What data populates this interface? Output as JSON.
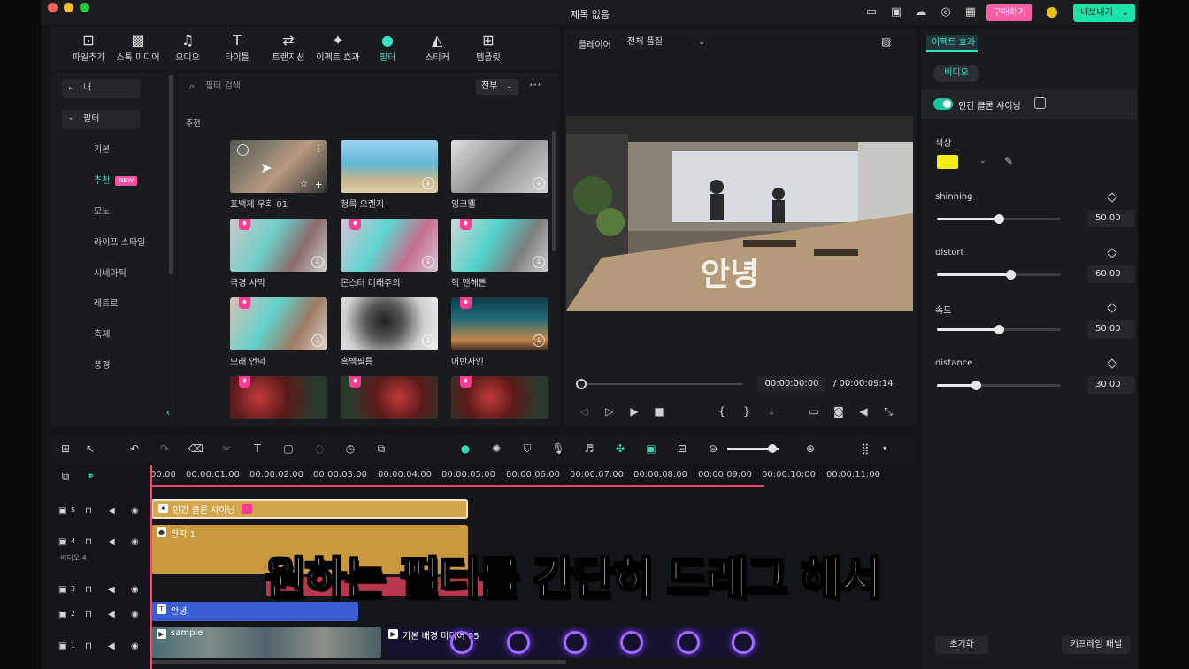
{
  "window": {
    "title": "제목 없음"
  },
  "header": {
    "buy_label": "구매하기",
    "export_label": "내보내기"
  },
  "media_tabs": [
    {
      "label": "파일추가",
      "icon": "import-icon"
    },
    {
      "label": "스톡 미디어",
      "icon": "stock-media-icon"
    },
    {
      "label": "오디오",
      "icon": "music-note-icon"
    },
    {
      "label": "타이틀",
      "icon": "title-text-icon"
    },
    {
      "label": "트랜지션",
      "icon": "transition-icon"
    },
    {
      "label": "이펙트 효과",
      "icon": "effects-sparkle-icon"
    },
    {
      "label": "필터",
      "icon": "filter-icon"
    },
    {
      "label": "스티커",
      "icon": "sticker-icon"
    },
    {
      "label": "템플릿",
      "icon": "template-icon"
    }
  ],
  "sidebar": {
    "mine_label": "내",
    "filter_label": "필터",
    "new_badge": "NEW",
    "items": [
      "기본",
      "추천",
      "모노",
      "라이프 스타일",
      "시네마틱",
      "레트로",
      "축제",
      "풍경"
    ]
  },
  "filters": {
    "search_placeholder": "필터 검색",
    "scope": "전부",
    "section": "추천",
    "items": [
      {
        "label": "표백제 우회 01"
      },
      {
        "label": "청록 오렌지"
      },
      {
        "label": "잉크웰"
      },
      {
        "label": "국경 사막"
      },
      {
        "label": "몬스터 미래주의"
      },
      {
        "label": "핵 맨해튼"
      },
      {
        "label": "모래 언덕"
      },
      {
        "label": "흑백필름"
      },
      {
        "label": "어반사인"
      }
    ]
  },
  "player": {
    "tab": "플레이어",
    "quality": "전체 품질",
    "overlay_text": "안녕",
    "current_time": "00:00:00:00",
    "total_time": "/ 00:00:09:14"
  },
  "effects": {
    "tab": "이펙트 효과",
    "video_btn": "비디오",
    "effect_name": "인간 클론 샤이닝",
    "color_label": "색상",
    "color_value": "#f2ee19",
    "params": [
      {
        "name": "shinning",
        "value": "50.00",
        "level": 0.5
      },
      {
        "name": "distort",
        "value": "60.00",
        "level": 0.6
      },
      {
        "name": "속도",
        "value": "50.00",
        "level": 0.5
      },
      {
        "name": "distance",
        "value": "30.00",
        "level": 0.3
      }
    ],
    "reset_label": "초기화",
    "keyframe_label": "키프레임 패널"
  },
  "timeline": {
    "ticks": [
      "00:00",
      "00:00:01:00",
      "00:00:02:00",
      "00:00:03:00",
      "00:00:04:00",
      "00:00:05:00",
      "00:00:06:00",
      "00:00:07:00",
      "00:00:08:00",
      "00:00:09:00",
      "00:00:10:00",
      "00:00:11:00"
    ],
    "tracks": [
      {
        "num": "5"
      },
      {
        "num": "4",
        "label": "비디오 4"
      },
      {
        "num": "3"
      },
      {
        "num": "2"
      },
      {
        "num": "1"
      }
    ],
    "clips": {
      "effect": "인간 클론 샤이닝",
      "filter": "한각 1",
      "title": "안녕",
      "video": "sample",
      "bg": "기본 배경 미디어 05"
    }
  },
  "subtitle": "원하는 필터를 간단히 드래그 해서"
}
